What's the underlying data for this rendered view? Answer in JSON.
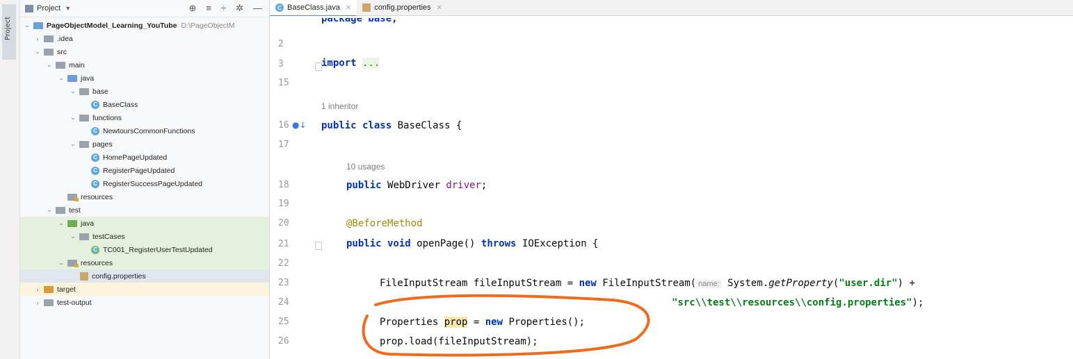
{
  "sidebar_strip": {
    "label": "Project"
  },
  "project_panel": {
    "title": "Project",
    "tree": [
      {
        "label": "PageObjectModel_Learning_YouTube",
        "path": "D:\\PageObjectM",
        "bold": true
      },
      {
        "label": ".idea"
      },
      {
        "label": "src"
      },
      {
        "label": "main"
      },
      {
        "label": "java"
      },
      {
        "label": "base"
      },
      {
        "label": "BaseClass"
      },
      {
        "label": "functions"
      },
      {
        "label": "NewtoursCommonFunctions"
      },
      {
        "label": "pages"
      },
      {
        "label": "HomePageUpdated"
      },
      {
        "label": "RegisterPageUpdated"
      },
      {
        "label": "RegisterSuccessPageUpdated"
      },
      {
        "label": "resources"
      },
      {
        "label": "test"
      },
      {
        "label": "java"
      },
      {
        "label": "testCases"
      },
      {
        "label": "TC001_RegisterUserTestUpdated"
      },
      {
        "label": "resources"
      },
      {
        "label": "config.properties"
      },
      {
        "label": "target"
      },
      {
        "label": "test-output"
      }
    ]
  },
  "tabs": [
    {
      "label": "BaseClass.java"
    },
    {
      "label": "config.properties"
    }
  ],
  "editor": {
    "line_numbers": [
      "2",
      "3",
      "15",
      "16",
      "17",
      "18",
      "19",
      "20",
      "21",
      "22",
      "23",
      "24",
      "25",
      "26"
    ],
    "package_partial": "package base;",
    "import_kw": "import",
    "import_dots": "...",
    "inheritor_note": "1 inheritor",
    "class_decl_kw": "public class",
    "class_name": "BaseClass {",
    "usages_note": "10 usages",
    "field_kw": "public",
    "field_type": "WebDriver",
    "field_name": "driver",
    "annotation": "@BeforeMethod",
    "method_kw1": "public void",
    "method_sig": "openPage()",
    "method_kw2": "throws",
    "method_exc": "IOException {",
    "line23_a": "FileInputStream fileInputStream = ",
    "line23_new": "new",
    "line23_b": " FileInputStream(",
    "line23_hint": "name:",
    "line23_c": " System.",
    "line23_method": "getProperty",
    "line23_d": "(",
    "line23_str": "\"user.dir\"",
    "line23_e": ") +",
    "line24_str": "\"src\\\\test\\\\resources\\\\config.properties\"",
    "line24_end": ");",
    "line25_a": "Properties ",
    "line25_var": "prop",
    "line25_b": " = ",
    "line25_new": "new",
    "line25_c": " Properties();",
    "line26": "prop.load(fileInputStream);"
  },
  "colors": {
    "annotation_circle": "#f06a1a"
  }
}
